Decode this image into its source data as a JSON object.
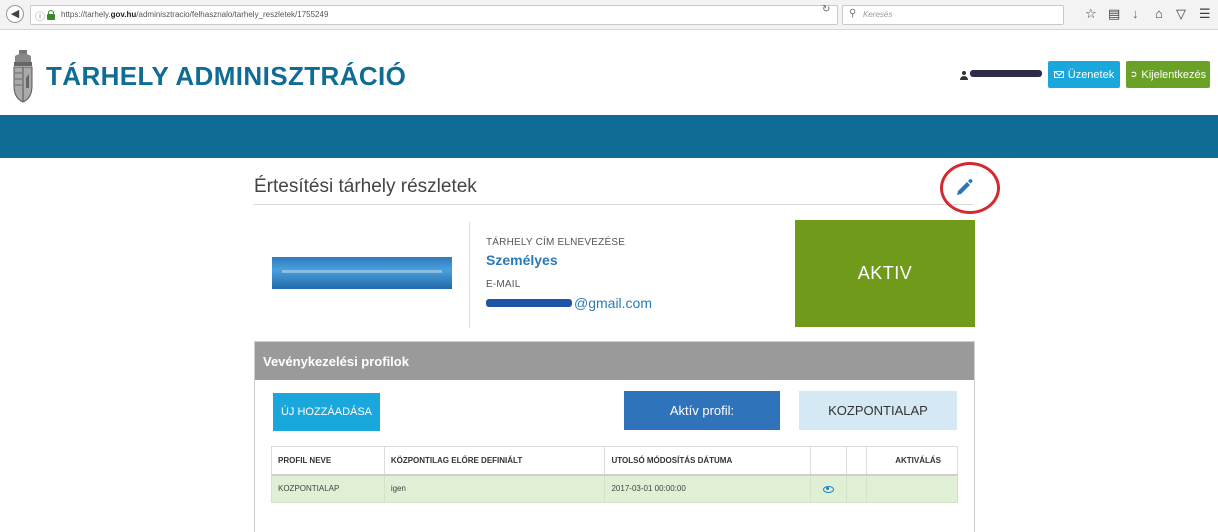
{
  "browser": {
    "url_prefix": "https://tarhely.",
    "url_domain": "gov.hu",
    "url_path": "/adminisztracio/felhasznalo/tarhely_reszletek/1755249",
    "search_placeholder": "Keresés"
  },
  "header": {
    "title": "TÁRHELY ADMINISZTRÁCIÓ",
    "messages_label": "Üzenetek",
    "logout_label": "Kijelentkezés"
  },
  "page": {
    "title": "Értesítési tárhely részletek"
  },
  "details": {
    "name_label": "TÁRHELY CÍM ELNEVEZÉSE",
    "name_value": "Személyes",
    "email_label": "E-MAIL",
    "email_domain": "@gmail.com",
    "status": "AKTIV"
  },
  "profiles": {
    "panel_title": "Vevénykezelési profilok",
    "add_button": "ÚJ HOZZÁADÁSA",
    "active_profile_label": "Aktív profil:",
    "active_profile_value": "KOZPONTIALAP",
    "columns": [
      "PROFIL NEVE",
      "KÖZPONTILAG ELŐRE DEFINIÁLT",
      "UTOLSÓ MÓDOSÍTÁS DÁTUMA",
      "",
      "",
      "AKTIVÁLÁS"
    ],
    "rows": [
      {
        "name": "KOZPONTIALAP",
        "predefined": "igen",
        "modified": "2017-03-01 00:00:00"
      }
    ]
  },
  "colors": {
    "brand_blue": "#0f6c95",
    "status_green": "#6f9a1a",
    "button_blue": "#1aa7dc",
    "logout_green": "#6aa127",
    "highlight_red": "#d42b30"
  }
}
